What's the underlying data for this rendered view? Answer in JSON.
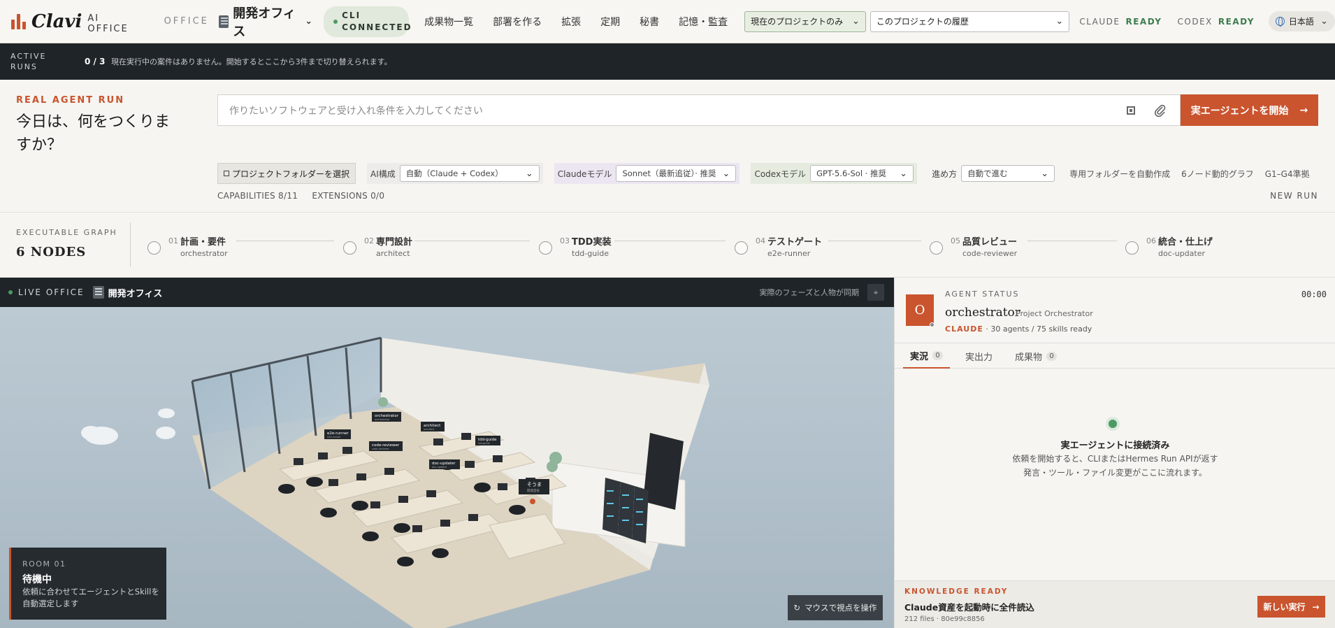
{
  "header": {
    "logo_word": "Clavi",
    "logo_sub": "AI OFFICE",
    "office_label": "OFFICE",
    "office_name": "開発オフィス",
    "cli_status": "CLI CONNECTED",
    "nav": [
      "成果物一覧",
      "部署を作る",
      "拡張",
      "定期",
      "秘書",
      "記憶・監査"
    ],
    "project_filter": "現在のプロジェクトのみ",
    "history_select": "このプロジェクトの履歴",
    "claude_label": "CLAUDE",
    "claude_state": "READY",
    "codex_label": "CODEX",
    "codex_state": "READY",
    "language": "日本語"
  },
  "runs": {
    "label": "ACTIVE RUNS",
    "count": "0 / 3",
    "message": "現在実行中の案件はありません。開始するとここから3件まで切り替えられます。"
  },
  "real_run": {
    "label": "REAL AGENT RUN",
    "title": "今日は、何をつくりますか？",
    "prompt_placeholder": "作りたいソフトウェアと受け入れ条件を入力してください",
    "start_button": "実エージェントを開始",
    "folder_button": "プロジェクトフォルダーを選択",
    "ai_config_label": "AI構成",
    "ai_config_value": "自動（Claude + Codex）",
    "claude_model_label": "Claudeモデル",
    "claude_model_value": "Sonnet（最新追従）· 推奨",
    "codex_model_label": "Codexモデル",
    "codex_model_value": "GPT-5.6-Sol · 推奨",
    "progress_label": "進め方",
    "progress_value": "自動で進む",
    "tails": [
      "専用フォルダーを自動作成",
      "6ノード動的グラフ",
      "G1–G4準拠"
    ],
    "capabilities": "CAPABILITIES 8/11",
    "extensions": "EXTENSIONS 0/0",
    "new_run": "NEW RUN"
  },
  "graph": {
    "label": "EXECUTABLE GRAPH",
    "count": "6 NODES",
    "nodes": [
      {
        "no": "01",
        "name": "計画・要件",
        "agent": "orchestrator"
      },
      {
        "no": "02",
        "name": "専門設計",
        "agent": "architect"
      },
      {
        "no": "03",
        "name": "TDD実装",
        "agent": "tdd-guide"
      },
      {
        "no": "04",
        "name": "テストゲート",
        "agent": "e2e-runner"
      },
      {
        "no": "05",
        "name": "品質レビュー",
        "agent": "code-reviewer"
      },
      {
        "no": "06",
        "name": "統合・仕上げ",
        "agent": "doc-updater"
      }
    ]
  },
  "office": {
    "live_label": "LIVE OFFICE",
    "name": "開発オフィス",
    "sync_note": "実際のフェーズと人物が同期",
    "tags": [
      {
        "name": "orchestrator",
        "role": "orchestrator"
      },
      {
        "name": "architect",
        "role": "architect"
      },
      {
        "name": "e2e-runner",
        "role": "e2e-runner"
      },
      {
        "name": "tdd-guide",
        "role": "tdd-guide"
      },
      {
        "name": "code-reviewer",
        "role": "code-reviewer"
      },
      {
        "name": "doc-updater",
        "role": "doc-updater"
      },
      {
        "name": "そうま",
        "role": "開発室長"
      }
    ],
    "room_label": "ROOM 01",
    "room_title": "待機中",
    "room_desc": "依頼に合わせてエージェントとSkillを自動選定します",
    "view_button": "マウスで視点を操作"
  },
  "agent": {
    "status_label": "AGENT STATUS",
    "avatar_letter": "O",
    "timer": "00:00",
    "name": "orchestrator",
    "role": "Project Orchestrator",
    "provider": "CLAUDE",
    "meta": "· 30 agents / 75 skills ready",
    "tabs": [
      {
        "label": "実況",
        "count": "0"
      },
      {
        "label": "実出力",
        "count": ""
      },
      {
        "label": "成果物",
        "count": "0"
      }
    ],
    "connected_title": "実エージェントに接続済み",
    "connected_desc1": "依頼を開始すると、CLIまたはHermes Run APIが返す",
    "connected_desc2": "発言・ツール・ファイル変更がここに流れます。",
    "knowledge_label": "KNOWLEDGE READY",
    "knowledge_title": "Claude資産を起動時に全件読込",
    "knowledge_sub": "212 files · 80e99c8856",
    "new_exec_button": "新しい実行"
  },
  "colors": {
    "accent": "#c9542e",
    "ready": "#3d7d4f",
    "dark": "#1f2428"
  },
  "icons": [
    "building-icon",
    "chevron-down-icon",
    "status-dot-icon",
    "globe-icon",
    "square-icon",
    "paperclip-icon",
    "arrow-right-icon",
    "crosshair-icon",
    "rotate-icon"
  ]
}
